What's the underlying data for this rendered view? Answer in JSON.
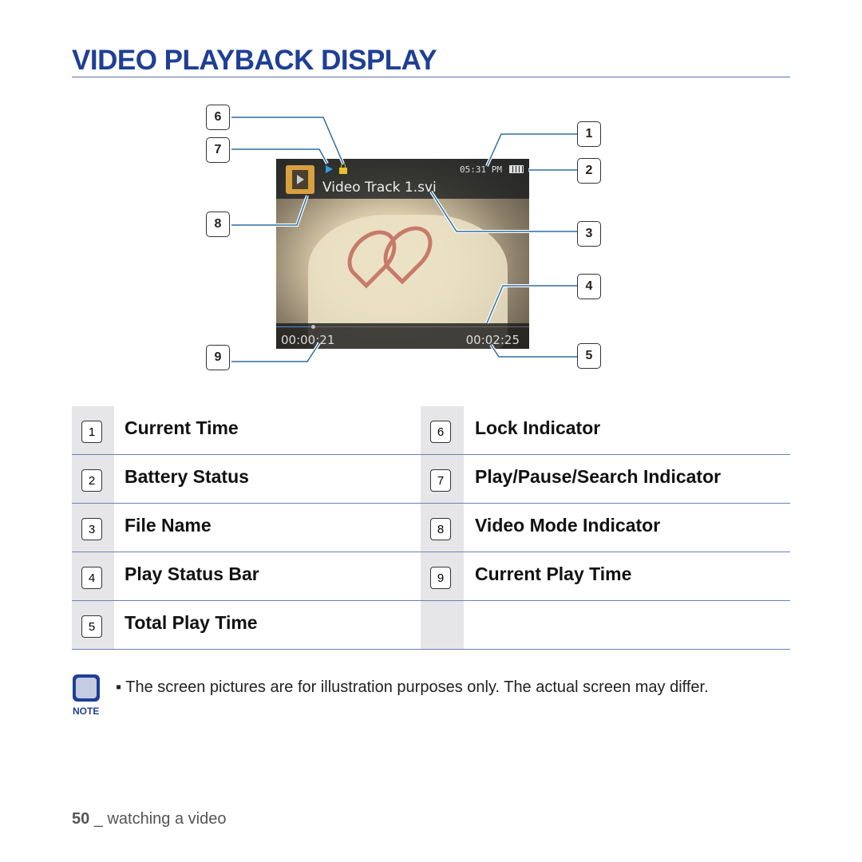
{
  "title": "VIDEO PLAYBACK DISPLAY",
  "screen": {
    "clock": "05:31 PM",
    "file_name": "Video Track 1.svi",
    "current_play_time": "00:00:21",
    "total_play_time": "00:02:25",
    "progress_percent": 14.5,
    "icons": [
      "video-mode-icon",
      "play-icon",
      "lock-icon",
      "battery-icon"
    ]
  },
  "callouts": [
    "1",
    "2",
    "3",
    "4",
    "5",
    "6",
    "7",
    "8",
    "9"
  ],
  "legend": [
    {
      "num": "1",
      "label": "Current Time"
    },
    {
      "num": "2",
      "label": "Battery Status"
    },
    {
      "num": "3",
      "label": "File Name"
    },
    {
      "num": "4",
      "label": "Play Status Bar"
    },
    {
      "num": "5",
      "label": "Total Play Time"
    },
    {
      "num": "6",
      "label": "Lock Indicator"
    },
    {
      "num": "7",
      "label": "Play/Pause/Search Indicator"
    },
    {
      "num": "8",
      "label": "Video Mode Indicator"
    },
    {
      "num": "9",
      "label": "Current Play Time"
    }
  ],
  "note": {
    "label": "NOTE",
    "text": "▪ The screen pictures are for illustration purposes only. The actual screen may differ."
  },
  "footer": {
    "page": "50",
    "text": " _ watching a video"
  },
  "colors": {
    "heading": "#1f3f95",
    "callout_line": "#2f6fa0"
  }
}
